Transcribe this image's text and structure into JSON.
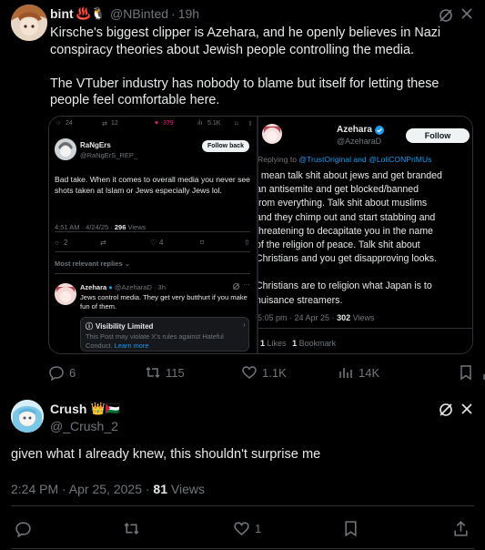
{
  "tweet1": {
    "display_name": "bint",
    "name_emojis": "♨️🐧",
    "handle": "@NBinted",
    "time": "19h",
    "paragraphs": [
      "Kirsche's biggest clipper is Azehara, and he openly believes in Nazi conspiracy theories about Jewish people controlling the media.",
      "The VTuber industry has nobody to blame but itself for letting these people feel comfortable here."
    ],
    "actions": {
      "replies": "6",
      "reposts": "115",
      "likes": "1.1K",
      "views": "14K"
    }
  },
  "embed_left": {
    "top_stats": {
      "replies": "24",
      "reposts": "12",
      "likes": "379",
      "views": "5.1K"
    },
    "author_name": "RaNgErs",
    "author_handle": "@RaNgErS_REP_",
    "follow_label": "Follow back",
    "text": "Bad take. When it comes to overall media you never see shots taken at Islam or Jews especially Jews lol.",
    "time": "4:51 AM · 4/24/25 ·",
    "views_count": "296",
    "views_label": "Views",
    "reply_count": "2",
    "like_count": "4",
    "relevant_label": "Most relevant replies ⌄",
    "reply_name": "Azehara",
    "reply_handle": "@AzeharaD · 3h",
    "reply_text": "Jews control media. They get very butthurt if you make fun of them.",
    "vis_title": "Visibility Limited",
    "vis_text": "This Post may violate X's rules against Hateful Conduct.",
    "vis_link": "Learn more"
  },
  "embed_right": {
    "author_name": "Azehara",
    "author_handle": "@AzeharaD",
    "follow_label": "Follow",
    "replying_prefix": "Replying to",
    "replying_to": "@TrustOriginal and @LoliCONPriMUs",
    "text_lines": [
      "I mean talk shit about jews and get branded",
      "an antisemite and get blocked/banned",
      "from everything.  Talk shit about muslims",
      "and they chimp out and start stabbing and",
      "threatening to decapitate you in the name",
      "of the religion of peace.  Talk shit about",
      "Christians and you get disapproving looks."
    ],
    "text2_lines": [
      "Christians are to religion what Japan is to",
      "nuisance streamers."
    ],
    "time": "5:05 pm · 24 Apr 25 ·",
    "views_count": "302",
    "views_label": "Views",
    "likes_count": "1",
    "likes_label": "Likes",
    "bookmarks_count": "1",
    "bookmarks_label": "Bookmark"
  },
  "tweet2": {
    "display_name": "Crush",
    "name_emojis": "👑🇵🇸",
    "handle": "@_Crush_2",
    "text": "given what I already knew, this shouldn't surprise me",
    "time": "2:24 PM · Apr 25, 2025 ·",
    "views_count": "81",
    "views_label": "Views",
    "actions": {
      "likes": "1"
    }
  },
  "colors": {
    "accent": "#1d9bf0",
    "muted": "#71767b",
    "text": "#e7e9ea",
    "border": "#2f3336",
    "pink": "#f91880"
  }
}
